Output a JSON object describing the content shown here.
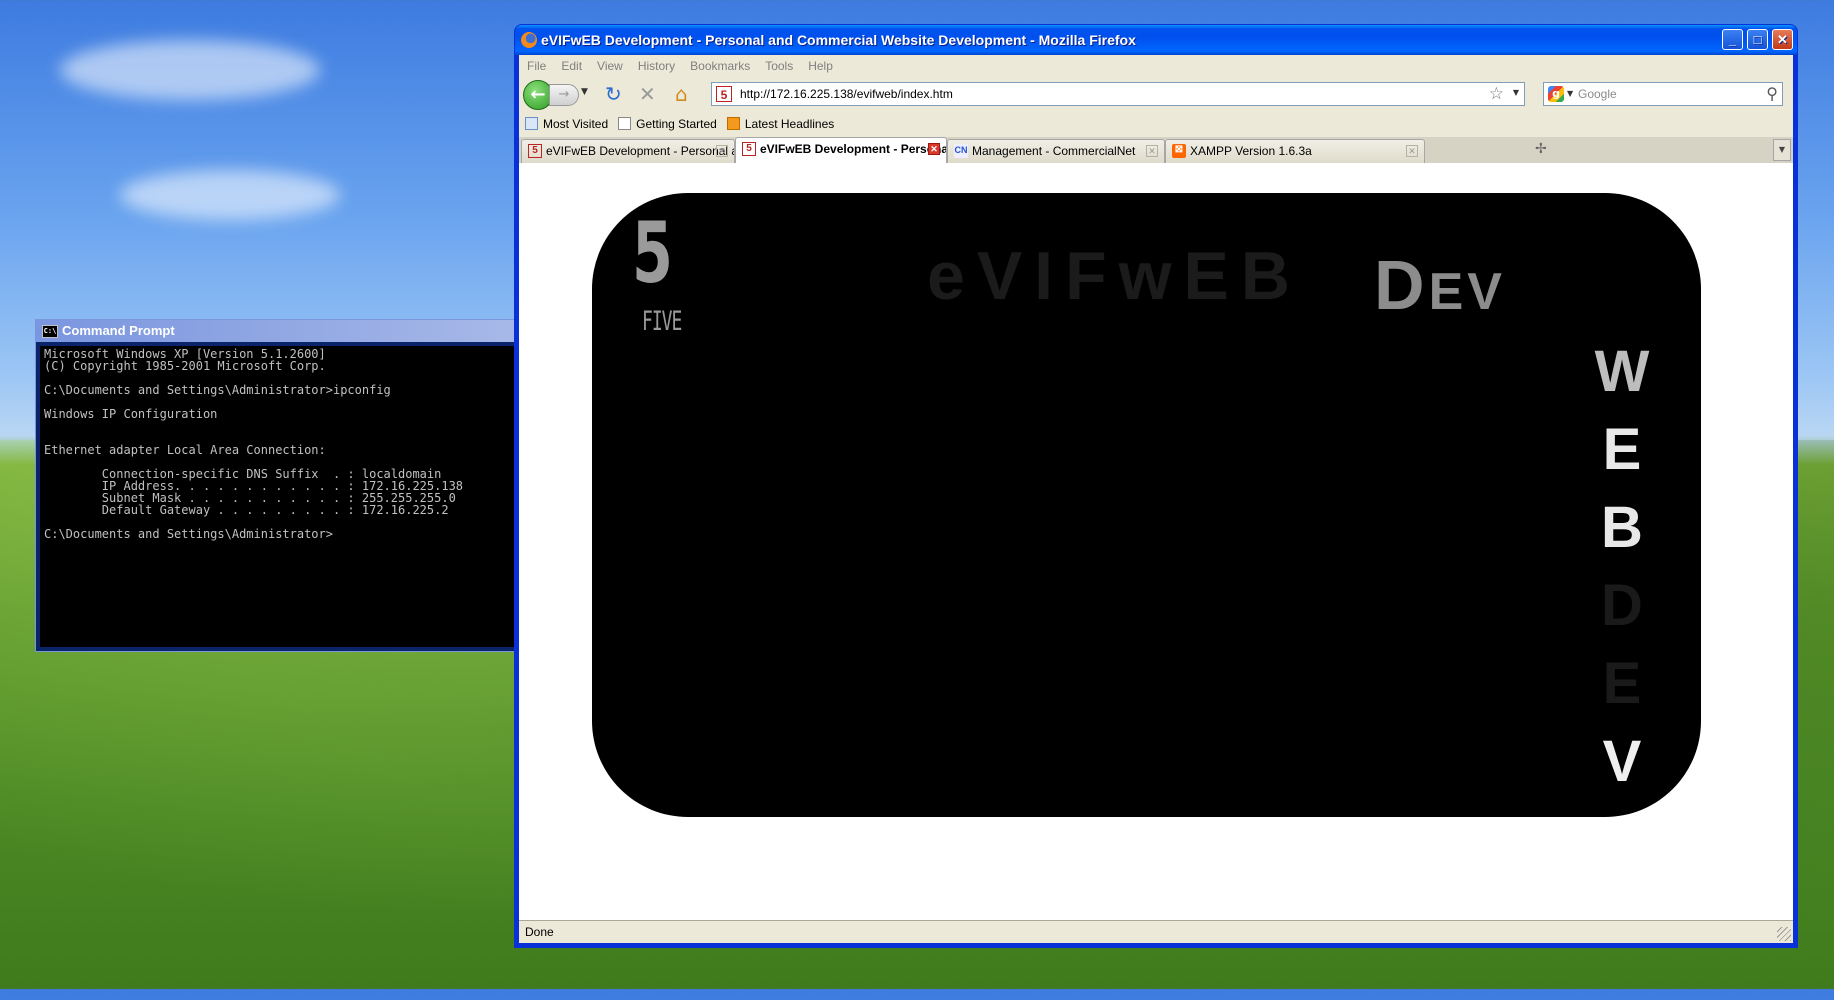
{
  "cmd": {
    "title": "Command Prompt",
    "lines": [
      "Microsoft Windows XP [Version 5.1.2600]",
      "(C) Copyright 1985-2001 Microsoft Corp.",
      "",
      "C:\\Documents and Settings\\Administrator>ipconfig",
      "",
      "Windows IP Configuration",
      "",
      "",
      "Ethernet adapter Local Area Connection:",
      "",
      "        Connection-specific DNS Suffix  . : localdomain",
      "        IP Address. . . . . . . . . . . . : 172.16.225.138",
      "        Subnet Mask . . . . . . . . . . . : 255.255.255.0",
      "        Default Gateway . . . . . . . . . : 172.16.225.2",
      "",
      "C:\\Documents and Settings\\Administrator>"
    ]
  },
  "firefox": {
    "title": "eVIFwEB Development - Personal and Commercial Website Development - Mozilla Firefox",
    "menu": [
      "File",
      "Edit",
      "View",
      "History",
      "Bookmarks",
      "Tools",
      "Help"
    ],
    "url": "http://172.16.225.138/evifweb/index.htm",
    "search_placeholder": "Google",
    "bookmarks": [
      {
        "label": "Most Visited",
        "icon": "most-visited-icon"
      },
      {
        "label": "Getting Started",
        "icon": "page-icon"
      },
      {
        "label": "Latest Headlines",
        "icon": "rss-feed-icon"
      }
    ],
    "tabs": [
      {
        "label": "eVIFwEB Development - Personal and ...",
        "icon": "five-favicon",
        "active": false
      },
      {
        "label": "eVIFwEB Development - Personal...",
        "icon": "five-favicon",
        "active": true
      },
      {
        "label": "Management - CommercialNet",
        "icon": "cn-favicon",
        "active": false
      },
      {
        "label": "XAMPP Version 1.6.3a",
        "icon": "xampp-favicon",
        "active": false
      }
    ],
    "status": "Done"
  },
  "page": {
    "logo_number": "5",
    "logo_word": "FIVE",
    "watermark": "eVIFwEB",
    "dev_big": "D",
    "dev_rest": "EV",
    "vertical_letters": [
      "W",
      "E",
      "B",
      "D",
      "E",
      "V"
    ]
  },
  "colors": {
    "xp_blue": "#0831d9",
    "chrome": "#ece9d8",
    "panel_black": "#000000",
    "accent_grey": "#8c8c8c"
  }
}
